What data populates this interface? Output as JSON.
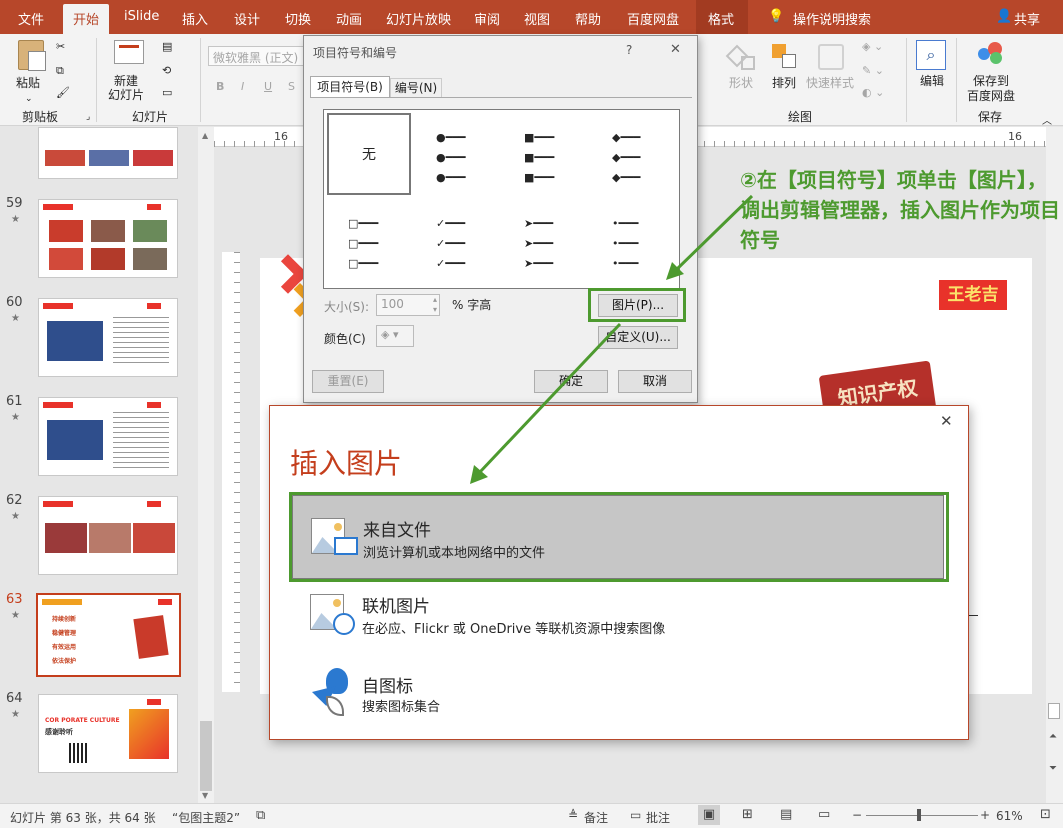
{
  "menu": [
    "文件",
    "开始",
    "iSlide",
    "插入",
    "设计",
    "切换",
    "动画",
    "幻灯片放映",
    "审阅",
    "视图",
    "帮助",
    "百度网盘",
    "格式",
    "操作说明搜索",
    "共享"
  ],
  "ribbon": {
    "paste": "粘贴",
    "clipboard": "剪贴板",
    "new_slide": "新建\n幻灯片",
    "slides": "幻灯片",
    "font_placeholder": "微软雅黑 (正文)",
    "bold": "B",
    "italic": "I",
    "underline": "U",
    "strike": "S",
    "shape": "形状",
    "arrange": "排列",
    "quick_style": "快速样式",
    "drawing": "绘图",
    "edit": "编辑",
    "save_to": "保存到",
    "baidu": "百度网盘",
    "save": "保存"
  },
  "slides": [
    {
      "num": "59"
    },
    {
      "num": "60"
    },
    {
      "num": "61"
    },
    {
      "num": "62"
    },
    {
      "num": "63"
    },
    {
      "num": "64"
    }
  ],
  "slide_texts": {
    "s63": [
      "持续创新",
      "稳健管理",
      "有效运用",
      "依法保护"
    ],
    "s64_a": "COR PORATE CULTURE",
    "s64_b": "感谢聆听",
    "wanglaoji": "王老吉",
    "zscq": "知识产权"
  },
  "ruler": {
    "h_left": "16",
    "h_right": "16"
  },
  "dialog1": {
    "title": "项目符号和编号",
    "help": "?",
    "close": "✕",
    "tab_bullet": "项目符号(B)",
    "tab_number": "编号(N)",
    "none": "无",
    "size_label": "大小(S):",
    "size_value": "100",
    "size_unit": "% 字高",
    "color_label": "颜色(C)",
    "picture_btn": "图片(P)...",
    "custom_btn": "自定义(U)...",
    "reset_btn": "重置(E)",
    "ok_btn": "确定",
    "cancel_btn": "取消"
  },
  "annotation": "②在【项目符号】项单击【图片】，调出剪辑管理器，插入图片作为项目符号",
  "dialog2": {
    "title": "插入图片",
    "close": "✕",
    "options": [
      {
        "title": "来自文件",
        "sub": "浏览计算机或本地网络中的文件"
      },
      {
        "title": "联机图片",
        "sub": "在必应、Flickr 或 OneDrive 等联机资源中搜索图像"
      },
      {
        "title": "自图标",
        "sub": "搜索图标集合"
      }
    ]
  },
  "status": {
    "slide_info": "幻灯片 第 63 张，共 64 张",
    "theme": "“包图主题2”",
    "notes": "备注",
    "comments": "批注",
    "zoom": "61%"
  },
  "colors": {
    "accent": "#b7472a",
    "green": "#4d9a2f"
  }
}
